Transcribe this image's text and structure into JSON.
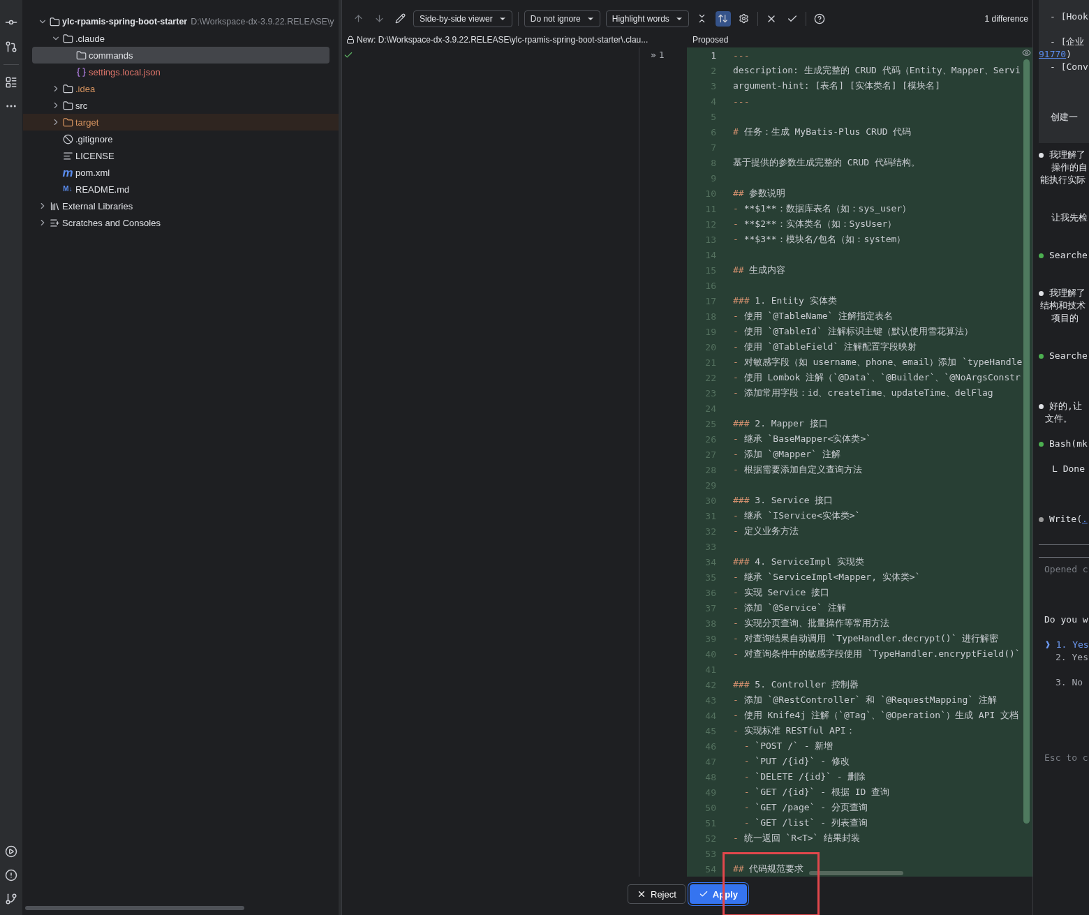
{
  "project_tree": {
    "items": [
      {
        "label": "ylc-rpamis-spring-boot-starter",
        "path": "D:\\Workspace-dx-3.9.22.RELEASE\\y",
        "kind": "module",
        "expanded": true,
        "selected": false,
        "excluded": false,
        "color": "#dfe1e5",
        "children": [
          {
            "label": ".claude",
            "kind": "folder",
            "expanded": true,
            "selected": false,
            "excluded": false,
            "color": "#dfe1e5",
            "children": [
              {
                "label": "commands",
                "kind": "folder",
                "selected": true,
                "excluded": false,
                "color": "#dfe1e5"
              },
              {
                "label": "settings.local.json",
                "kind": "json",
                "selected": false,
                "excluded": false,
                "color": "#e0766b"
              }
            ]
          },
          {
            "label": ".idea",
            "kind": "folder",
            "expanded": false,
            "selected": false,
            "excluded": false,
            "color": "#d5935f"
          },
          {
            "label": "src",
            "kind": "folder",
            "expanded": false,
            "selected": false,
            "excluded": false,
            "color": "#dfe1e5"
          },
          {
            "label": "target",
            "kind": "folder",
            "expanded": false,
            "selected": false,
            "excluded": true,
            "color": "#d5935f"
          },
          {
            "label": ".gitignore",
            "kind": "ignore",
            "selected": false,
            "excluded": false,
            "color": "#dfe1e5"
          },
          {
            "label": "LICENSE",
            "kind": "text",
            "selected": false,
            "excluded": false,
            "color": "#dfe1e5"
          },
          {
            "label": "pom.xml",
            "kind": "maven",
            "icon_text": "m",
            "selected": false,
            "excluded": false,
            "color": "#dfe1e5"
          },
          {
            "label": "README.md",
            "kind": "markdown",
            "icon_text": "M↓",
            "selected": false,
            "excluded": false,
            "color": "#dfe1e5"
          }
        ]
      },
      {
        "label": "External Libraries",
        "kind": "library",
        "expanded": false,
        "selected": false,
        "excluded": false,
        "color": "#dfe1e5"
      },
      {
        "label": "Scratches and Consoles",
        "kind": "scratches",
        "expanded": false,
        "selected": false,
        "excluded": false,
        "color": "#dfe1e5"
      }
    ]
  },
  "diff": {
    "toolbar": {
      "dropdowns": [
        "Side-by-side viewer",
        "Do not ignore",
        "Highlight words"
      ],
      "sync_scroll": {
        "selected": true
      },
      "differences": "1 difference"
    },
    "left_title": "New: D:\\Workspace-dx-3.9.22.RELEASE\\ylc-rpamis-spring-boot-starter\\.clau...",
    "right_title": "Proposed",
    "gutter": {
      "marker": "»",
      "line": "1"
    },
    "lines": [
      {
        "number": "1",
        "marker": "---",
        "current": true
      },
      {
        "number": "2",
        "text": "description: 生成完整的 CRUD 代码（Entity、Mapper、Servi",
        "current": false
      },
      {
        "number": "3",
        "text": "argument-hint: [表名] [实体类名] [模块名]",
        "current": false
      },
      {
        "number": "4",
        "marker": "---",
        "current": false
      },
      {
        "number": "5",
        "current": false
      },
      {
        "number": "6",
        "marker": "#",
        "text": "任务：生成 MyBatis-Plus CRUD 代码",
        "current": false
      },
      {
        "number": "7",
        "current": false
      },
      {
        "number": "8",
        "text": "基于提供的参数生成完整的 CRUD 代码结构。",
        "current": false
      },
      {
        "number": "9",
        "current": false
      },
      {
        "number": "10",
        "marker": "##",
        "text": "参数说明",
        "current": false
      },
      {
        "number": "11",
        "marker": "-",
        "text": "**$1**：数据库表名（如：sys_user）",
        "current": false
      },
      {
        "number": "12",
        "marker": "-",
        "text": "**$2**：实体类名（如：SysUser）",
        "current": false
      },
      {
        "number": "13",
        "marker": "-",
        "text": "**$3**：模块名/包名（如：system）",
        "current": false
      },
      {
        "number": "14",
        "current": false
      },
      {
        "number": "15",
        "marker": "##",
        "text": "生成内容",
        "current": false
      },
      {
        "number": "16",
        "current": false
      },
      {
        "number": "17",
        "marker": "###",
        "text": "1. Entity 实体类",
        "current": false
      },
      {
        "number": "18",
        "marker": "-",
        "text": "使用 `@TableName` 注解指定表名",
        "current": false
      },
      {
        "number": "19",
        "marker": "-",
        "text": "使用 `@TableId` 注解标识主键（默认使用雪花算法）",
        "current": false
      },
      {
        "number": "20",
        "marker": "-",
        "text": "使用 `@TableField` 注解配置字段映射",
        "current": false
      },
      {
        "number": "21",
        "marker": "-",
        "text": "对敏感字段（如 username、phone、email）添加 `typeHandle",
        "current": false
      },
      {
        "number": "22",
        "marker": "-",
        "text": "使用 Lombok 注解（`@Data`、`@Builder`、`@NoArgsConstr",
        "current": false
      },
      {
        "number": "23",
        "marker": "-",
        "text": "添加常用字段：id、createTime、updateTime、delFlag",
        "current": false
      },
      {
        "number": "24",
        "current": false
      },
      {
        "number": "25",
        "marker": "###",
        "text": "2. Mapper 接口",
        "current": false
      },
      {
        "number": "26",
        "marker": "-",
        "text": "继承 `BaseMapper<实体类>`",
        "current": false
      },
      {
        "number": "27",
        "marker": "-",
        "text": "添加 `@Mapper` 注解",
        "current": false
      },
      {
        "number": "28",
        "marker": "-",
        "text": "根据需要添加自定义查询方法",
        "current": false
      },
      {
        "number": "29",
        "current": false
      },
      {
        "number": "30",
        "marker": "###",
        "text": "3. Service 接口",
        "current": false
      },
      {
        "number": "31",
        "marker": "-",
        "text": "继承 `IService<实体类>`",
        "current": false
      },
      {
        "number": "32",
        "marker": "-",
        "text": "定义业务方法",
        "current": false
      },
      {
        "number": "33",
        "current": false
      },
      {
        "number": "34",
        "marker": "###",
        "text": "4. ServiceImpl 实现类",
        "current": false
      },
      {
        "number": "35",
        "marker": "-",
        "text": "继承 `ServiceImpl<Mapper, 实体类>`",
        "current": false
      },
      {
        "number": "36",
        "marker": "-",
        "text": "实现 Service 接口",
        "current": false
      },
      {
        "number": "37",
        "marker": "-",
        "text": "添加 `@Service` 注解",
        "current": false
      },
      {
        "number": "38",
        "marker": "-",
        "text": "实现分页查询、批量操作等常用方法",
        "current": false
      },
      {
        "number": "39",
        "marker": "-",
        "text": "对查询结果自动调用 `TypeHandler.decrypt()` 进行解密",
        "current": false
      },
      {
        "number": "40",
        "marker": "-",
        "text": "对查询条件中的敏感字段使用 `TypeHandler.encryptField()`",
        "current": false
      },
      {
        "number": "41",
        "current": false
      },
      {
        "number": "42",
        "marker": "###",
        "text": "5. Controller 控制器",
        "current": false
      },
      {
        "number": "43",
        "marker": "-",
        "text": "添加 `@RestController` 和 `@RequestMapping` 注解",
        "current": false
      },
      {
        "number": "44",
        "marker": "-",
        "text": "使用 Knife4j 注解（`@Tag`、`@Operation`）生成 API 文档",
        "current": false
      },
      {
        "number": "45",
        "marker": "-",
        "text": "实现标准 RESTful API：",
        "current": false
      },
      {
        "number": "46",
        "marker": "  -",
        "text": "`POST /` - 新增",
        "current": false
      },
      {
        "number": "47",
        "marker": "  -",
        "text": "`PUT /{id}` - 修改",
        "current": false
      },
      {
        "number": "48",
        "marker": "  -",
        "text": "`DELETE /{id}` - 删除",
        "current": false
      },
      {
        "number": "49",
        "marker": "  -",
        "text": "`GET /{id}` - 根据 ID 查询",
        "current": false
      },
      {
        "number": "50",
        "marker": "  -",
        "text": "`GET /page` - 分页查询",
        "current": false
      },
      {
        "number": "51",
        "marker": "  -",
        "text": "`GET /list` - 列表查询",
        "current": false
      },
      {
        "number": "52",
        "marker": "-",
        "text": "统一返回 `R<T>` 结果封装",
        "current": false
      },
      {
        "number": "53",
        "current": false
      },
      {
        "number": "54",
        "marker": "##",
        "text": "代码规范要求",
        "current": false
      }
    ],
    "buttons": [
      {
        "label": "Reject",
        "kind": "secondary"
      },
      {
        "label": "Apply",
        "kind": "primary"
      }
    ]
  },
  "terminal": {
    "rows": [
      {
        "kind": "text",
        "text": "- [Hook"
      },
      {
        "kind": "text",
        "text": "- [企业"
      },
      {
        "kind": "link",
        "text": "91770",
        "tail": ")"
      },
      {
        "kind": "text",
        "text": "- [Conv"
      },
      {
        "kind": "text",
        "text": "创建一"
      },
      {
        "kind": "bullet",
        "color": "#dfe1e5",
        "text": "我理解了"
      },
      {
        "kind": "text",
        "text": "操作的自"
      },
      {
        "kind": "text",
        "text": "能执行实际"
      },
      {
        "kind": "text",
        "text": "让我先检"
      },
      {
        "kind": "bullet",
        "color": "#4caf50",
        "text": "Searche"
      },
      {
        "kind": "bullet",
        "color": "#dfe1e5",
        "text": "我理解了"
      },
      {
        "kind": "text",
        "text": "结构和技术"
      },
      {
        "kind": "text",
        "text": "项目的"
      },
      {
        "kind": "bullet",
        "color": "#4caf50",
        "text": "Searche"
      },
      {
        "kind": "bullet",
        "color": "#dfe1e5",
        "text": "好的,让"
      },
      {
        "kind": "text",
        "text": "文件。"
      },
      {
        "kind": "bullet",
        "color": "#4caf50",
        "text": "Bash(mk"
      },
      {
        "kind": "text",
        "text": "L  Done"
      },
      {
        "kind": "bullet",
        "color": "#9a9a9a",
        "text": "Write(",
        "link": "."
      },
      {
        "kind": "hint",
        "text": "Opened c"
      },
      {
        "kind": "text",
        "text": "Do you w"
      },
      {
        "kind": "choice",
        "text": "❱ 1. Yes",
        "selected": true
      },
      {
        "kind": "choice",
        "text": "2. Yes",
        "selected": false
      },
      {
        "kind": "choice",
        "text": "3. No",
        "selected": false
      },
      {
        "kind": "hint",
        "text": "Esc to c"
      }
    ]
  }
}
